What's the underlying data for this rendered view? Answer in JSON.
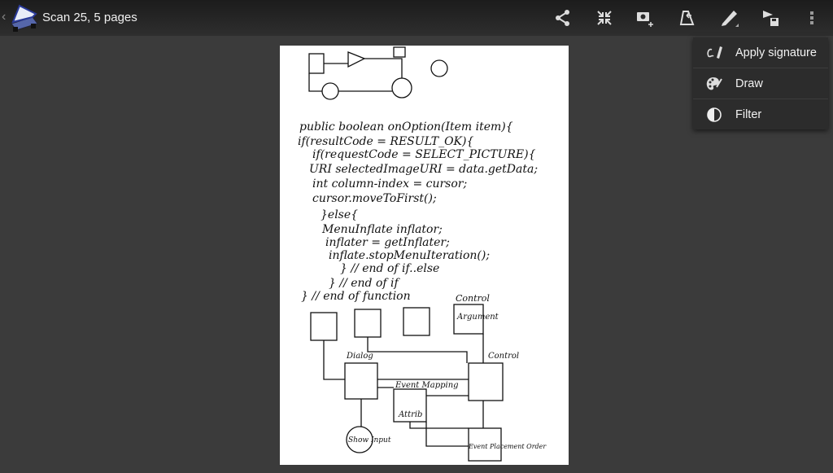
{
  "header": {
    "back_icon": "chevron-left-icon",
    "app_icon": "scanner-icon",
    "title": "Scan 25, 5 pages",
    "actions": [
      "share-icon",
      "collapse-icon",
      "add-photo-icon",
      "crop-icon",
      "pencil-icon",
      "send-save-icon",
      "more-vert-icon"
    ]
  },
  "menu": {
    "items": [
      {
        "label": "Apply signature",
        "icon": "signature-icon"
      },
      {
        "label": "Draw",
        "icon": "palette-icon"
      },
      {
        "label": "Filter",
        "icon": "contrast-icon"
      }
    ]
  },
  "document": {
    "lines": [
      "public boolean onOption(Item item){",
      "if(resultCode = RESULT_OK){",
      "if(requestCode = SELECT_PICTURE){",
      "URI selectedImageURI = data.getData;",
      "int column-index = cursor;",
      "cursor.moveToFirst();",
      "}else{",
      "MenuInflate inflator;",
      "inflater = getInflater;",
      "inflate.stopMenuIteration();",
      "} // end of if..else",
      "} // end of if",
      "} // end of function"
    ],
    "diagram_labels": [
      "Control",
      "Event",
      "Argument",
      "Dialog",
      "Control",
      "Event Mapping",
      "Attrib",
      "Show Input",
      "Event Placement Order"
    ]
  }
}
